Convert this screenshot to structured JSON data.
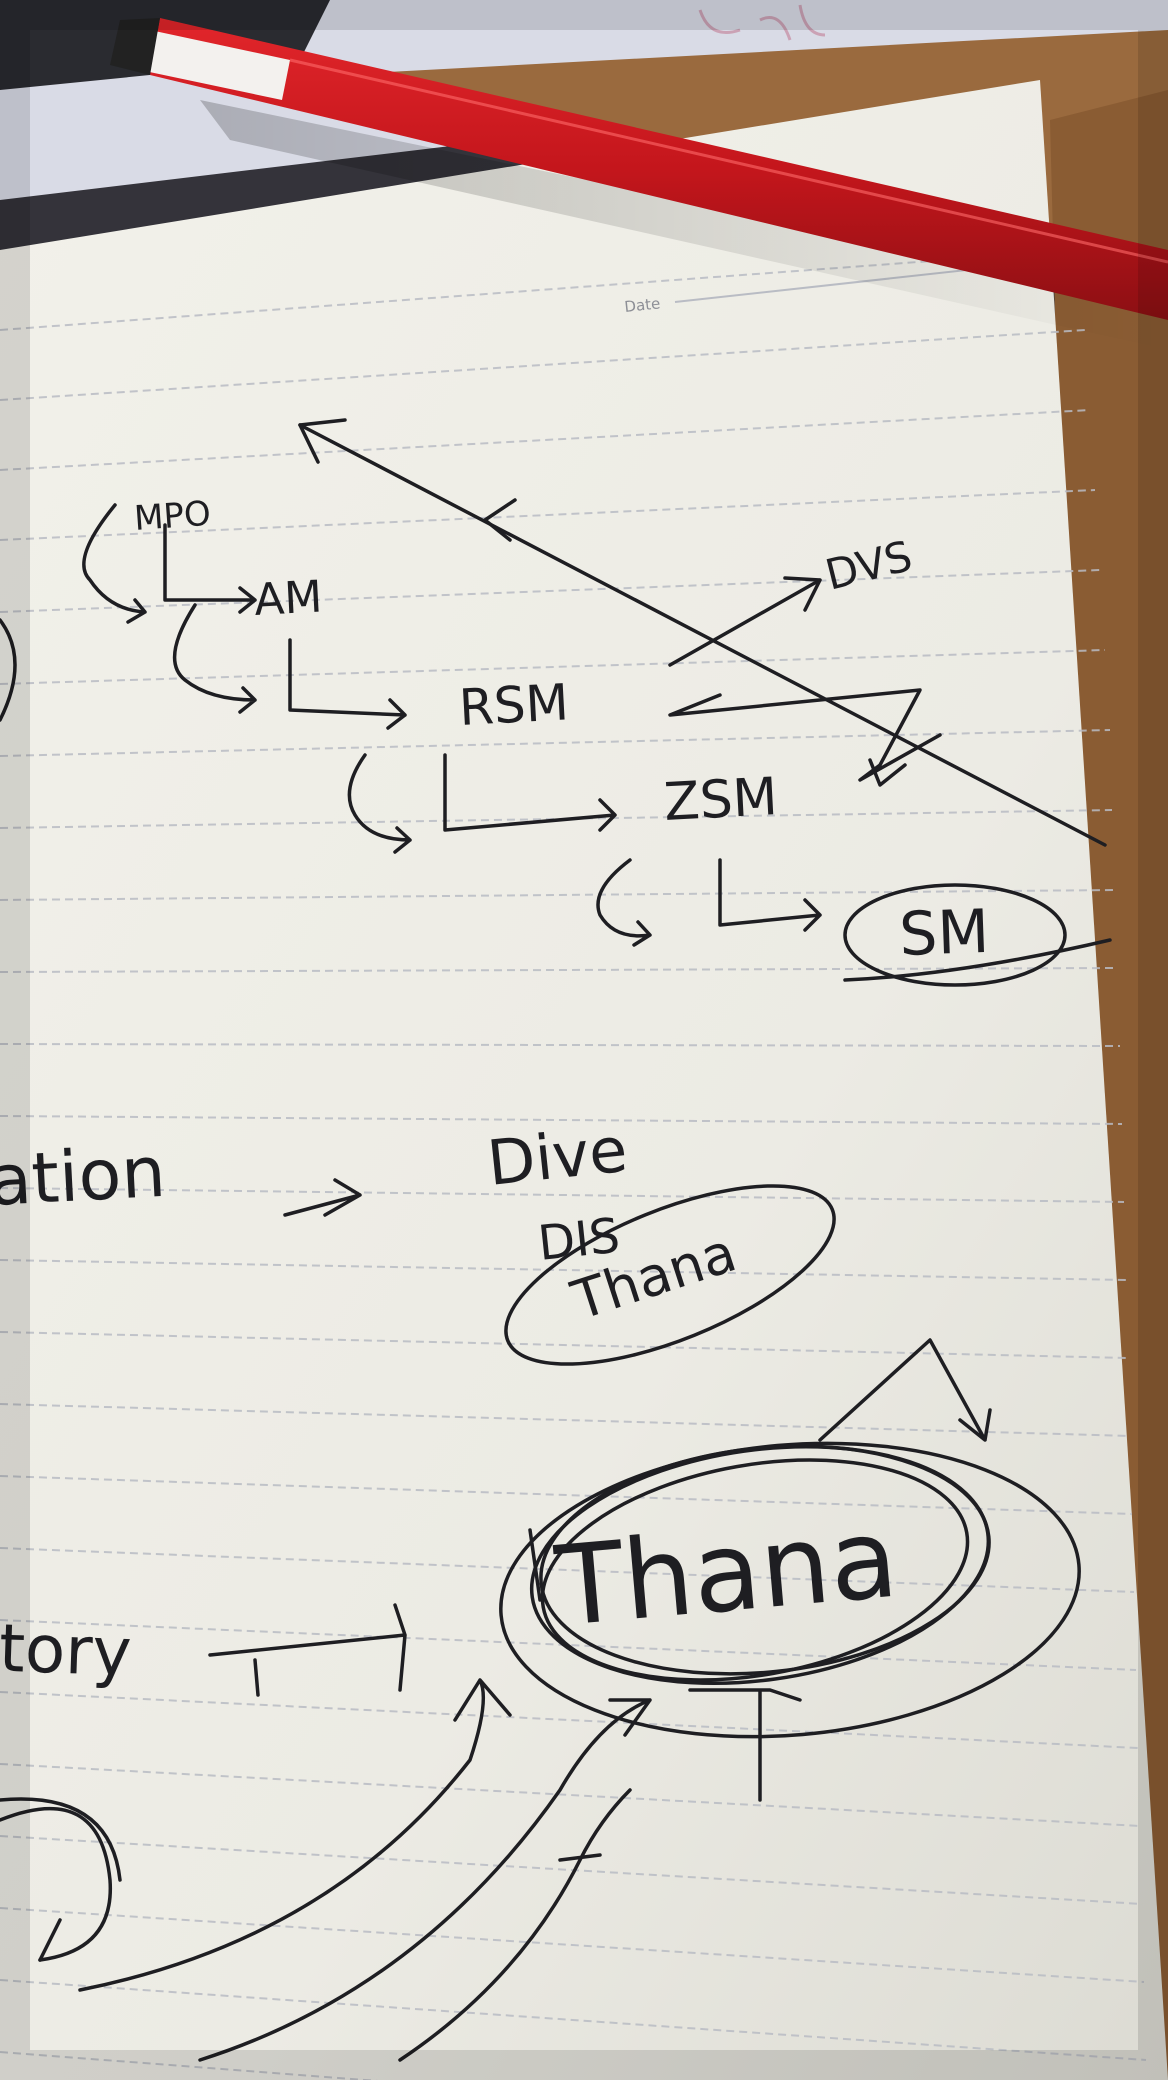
{
  "photo": {
    "subject": "handwritten notes on a lined notepad with a red pencil",
    "printed_text": {
      "date_label": "Date"
    },
    "handwriting": {
      "hierarchy": [
        "MPO",
        "AM",
        "RSM",
        "ZSM",
        "SM"
      ],
      "upward_label": "DVS",
      "partial_left_1": "ation",
      "middle_words": [
        "Dive",
        "DIS",
        "Thana"
      ],
      "big_word": "Thana",
      "partial_left_2": "itory"
    },
    "colors": {
      "paper": "#ecebe4",
      "rule_line": "#b9bcc4",
      "ink": "#1e1e22",
      "pencil_red": "#c4161c",
      "desk": "#9a6a3e"
    }
  }
}
